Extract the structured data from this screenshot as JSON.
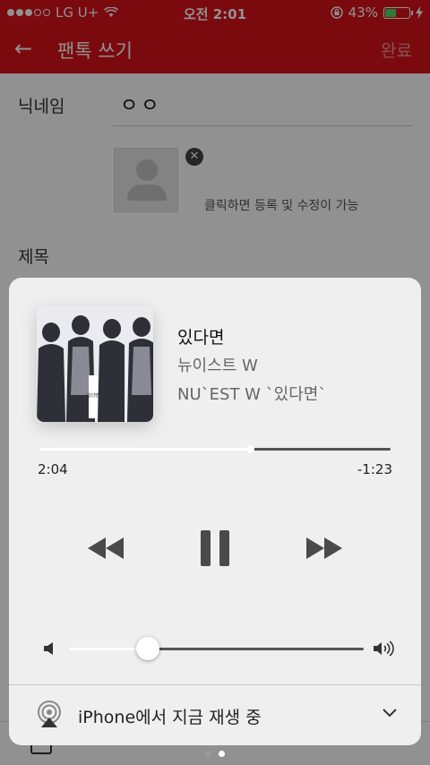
{
  "status_bar": {
    "carrier": "LG U+",
    "time": "오전 2:01",
    "battery": "43%"
  },
  "app": {
    "title": "팬톡 쓰기",
    "done_label": "완료",
    "nickname_label": "닉네임",
    "nickname_value": "ㅇㅇ",
    "image_hint": "클릭하면 등록 및 수정이 가능",
    "subject_label": "제목"
  },
  "now_playing": {
    "title": "있다면",
    "artist": "뉴이스트 W",
    "album": "NU`EST W `있다면`",
    "elapsed": "2:04",
    "remaining": "-1:23",
    "progress": 0.6,
    "volume": 0.27,
    "output_device_text": "iPhone에서 지금 재생 중",
    "album_art_text": "있다면"
  },
  "page_indicator": {
    "count": 2,
    "active": 2
  },
  "colors": {
    "header_red": "#d8121b",
    "card_bg": "#efefef",
    "control_dark": "#4a4a4a"
  },
  "icons": [
    "back-arrow-icon",
    "remove-icon",
    "rewind-icon",
    "pause-icon",
    "fast-forward-icon",
    "volume-low-icon",
    "volume-high-icon",
    "airplay-icon",
    "chevron-down-icon"
  ]
}
